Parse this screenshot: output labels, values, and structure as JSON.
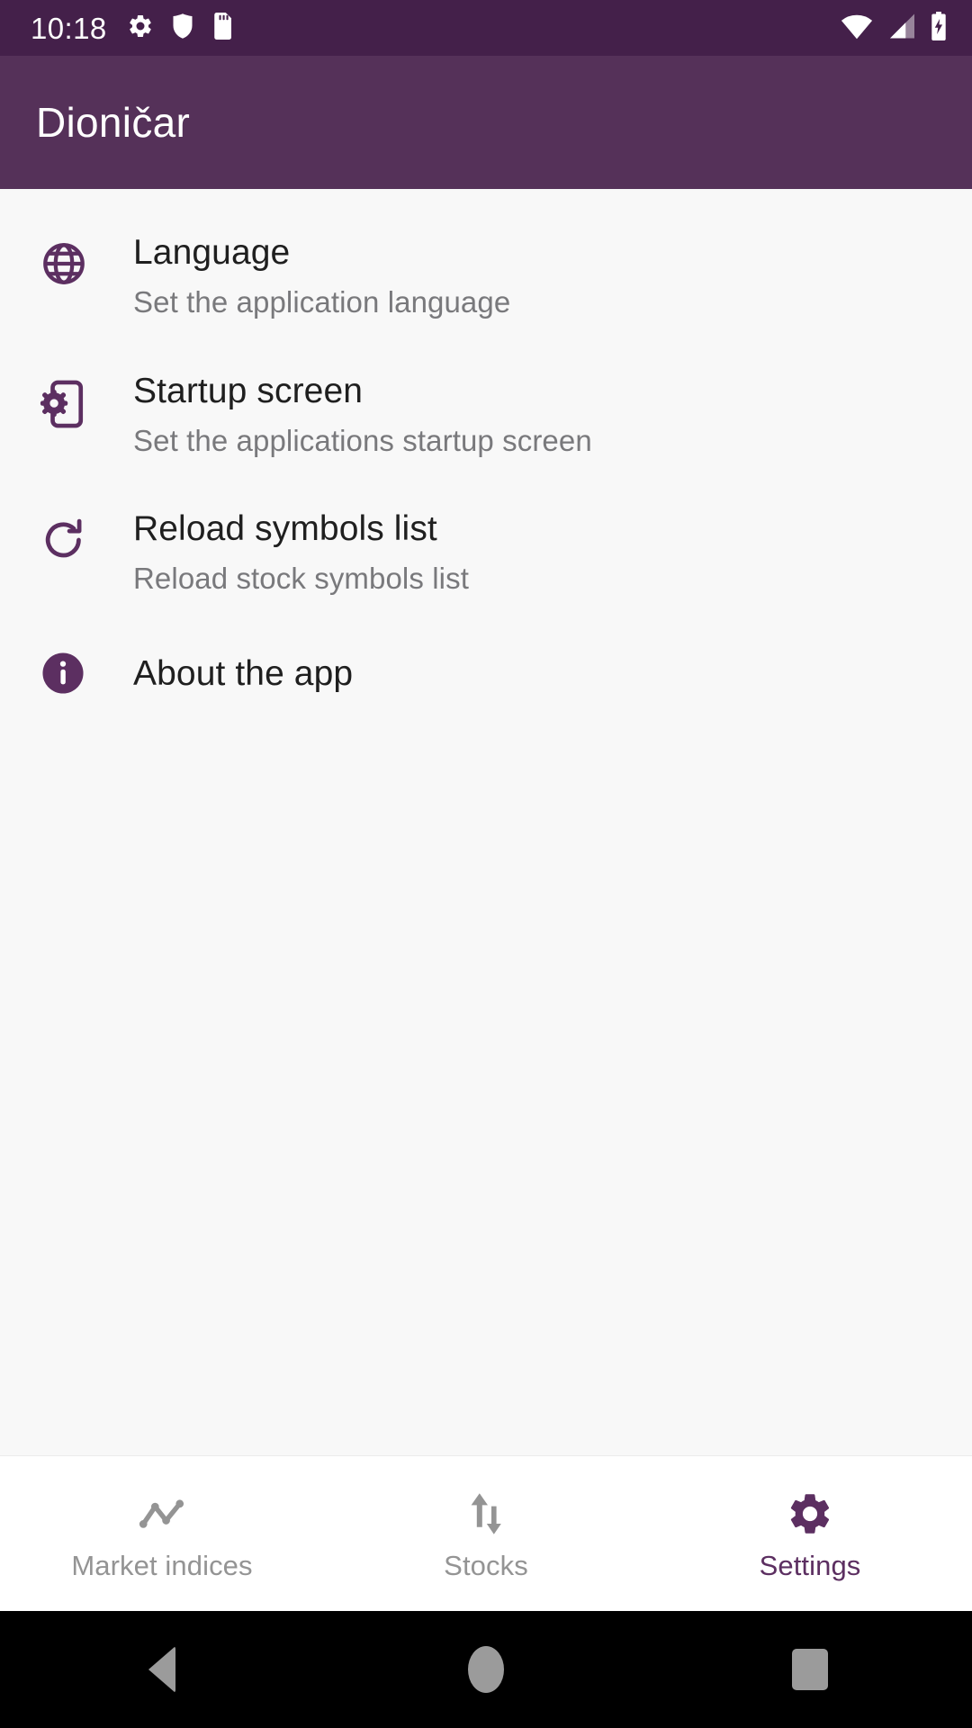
{
  "status_bar": {
    "clock": "10:18",
    "left_icons": [
      "gear-icon",
      "shield-icon",
      "sd-card-icon"
    ],
    "right_icons": [
      "wifi-icon",
      "cellular-signal-icon",
      "battery-charging-icon"
    ],
    "background": "#44204a"
  },
  "app_bar": {
    "title": "Dioničar",
    "background": "#553159",
    "text_color": "#ffffff"
  },
  "theme": {
    "accent": "#5c2f61",
    "icon_purple": "#5c2f61",
    "content_background": "#f8f8f8",
    "primary_text": "#1f1f1f",
    "secondary_text": "#79797c",
    "inactive_nav": "#949494"
  },
  "settings": {
    "items": [
      {
        "icon": "globe-icon",
        "title": "Language",
        "subtitle": "Set the application language"
      },
      {
        "icon": "phone-settings-icon",
        "title": "Startup screen",
        "subtitle": "Set the applications startup screen"
      },
      {
        "icon": "refresh-icon",
        "title": "Reload symbols list",
        "subtitle": "Reload stock symbols list"
      },
      {
        "icon": "info-circle-icon",
        "title": "About the app",
        "subtitle": ""
      }
    ]
  },
  "bottom_nav": {
    "items": [
      {
        "icon": "show-chart-icon",
        "label": "Market indices",
        "active": false
      },
      {
        "icon": "swap-vertical-icon",
        "label": "Stocks",
        "active": false
      },
      {
        "icon": "gear-icon",
        "label": "Settings",
        "active": true
      }
    ]
  },
  "system_nav": {
    "back": "back-button",
    "home": "home-button",
    "recents": "recents-button"
  }
}
